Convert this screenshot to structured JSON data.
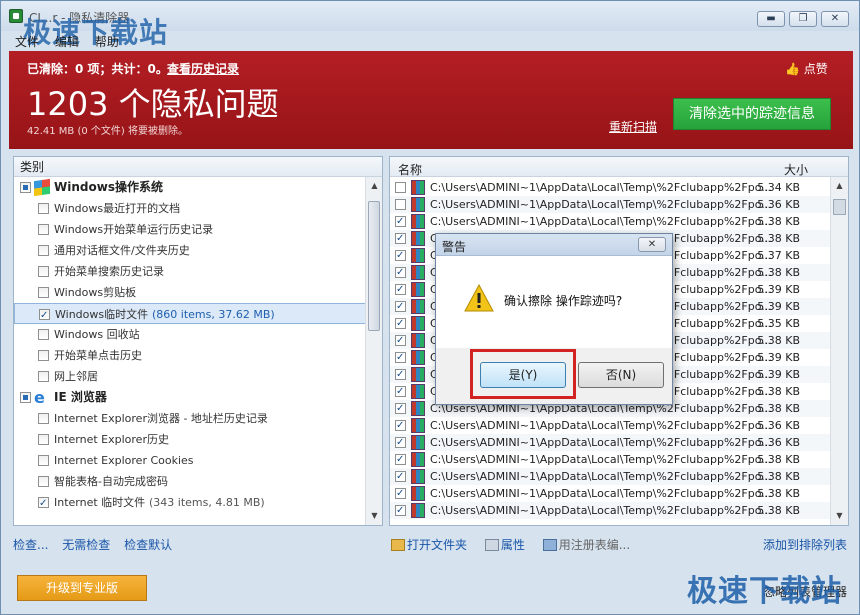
{
  "window": {
    "title": "CI...r - 隐私清除器",
    "minimize_icon": "minimize-icon",
    "restore_icon": "restore-icon",
    "close_icon": "close-icon"
  },
  "menu": [
    "文件",
    "编辑",
    "帮助"
  ],
  "watermark": "极速下载站",
  "banner": {
    "cleared_text": "已清除：0 项；共计：0。",
    "history_link": "查看历史记录",
    "issues_count": "1203 个隐私问题",
    "size_line": "42.41 MB (0 个文件) 将要被删除。",
    "like_label": "点赞",
    "rescan_link": "重新扫描",
    "clean_button": "清除选中的踪迹信息"
  },
  "left_panel": {
    "header": "类别",
    "rows": [
      {
        "type": "cat",
        "label": "Windows操作系统",
        "checkbox": "partial",
        "icon": "windows-logo-icon"
      },
      {
        "type": "item",
        "label": "Windows最近打开的文档",
        "checked": false
      },
      {
        "type": "item",
        "label": "Windows开始菜单运行历史记录",
        "checked": false
      },
      {
        "type": "item",
        "label": "通用对话框文件/文件夹历史",
        "checked": false
      },
      {
        "type": "item",
        "label": "开始菜单搜索历史记录",
        "checked": false
      },
      {
        "type": "item",
        "label": "Windows剪贴板",
        "checked": false
      },
      {
        "type": "item",
        "label": "Windows临时文件",
        "extra": "(860 items, 37.62 MB)",
        "checked": true,
        "selected": true
      },
      {
        "type": "item",
        "label": "Windows 回收站",
        "checked": false
      },
      {
        "type": "item",
        "label": "开始菜单点击历史",
        "checked": false
      },
      {
        "type": "item",
        "label": "网上邻居",
        "checked": false
      },
      {
        "type": "cat",
        "label": "IE 浏览器",
        "checkbox": "partial",
        "icon": "ie-logo-icon"
      },
      {
        "type": "item",
        "label": "Internet Explorer浏览器 - 地址栏历史记录",
        "checked": false
      },
      {
        "type": "item",
        "label": "Internet Explorer历史",
        "checked": false
      },
      {
        "type": "item",
        "label": "Internet Explorer Cookies",
        "checked": false
      },
      {
        "type": "item",
        "label": "智能表格-自动完成密码",
        "checked": false
      },
      {
        "type": "item",
        "label": "Internet 临时文件",
        "extra": "(343 items, 4.81 MB)",
        "checked": true
      }
    ]
  },
  "right_panel": {
    "col_name": "名称",
    "col_size": "大小",
    "files": [
      {
        "path": "C:\\Users\\ADMINI~1\\AppData\\Local\\Temp\\%2Fclubapp%2Fpo...",
        "size": "5.34 KB",
        "checked": false
      },
      {
        "path": "C:\\Users\\ADMINI~1\\AppData\\Local\\Temp\\%2Fclubapp%2Fpo...",
        "size": "5.36 KB",
        "checked": false
      },
      {
        "path": "C:\\Users\\ADMINI~1\\AppData\\Local\\Temp\\%2Fclubapp%2Fpo...",
        "size": "5.38 KB",
        "checked": true
      },
      {
        "path": "C:\\Users\\ADMINI~1\\AppData\\Local\\Temp\\%2Fclubapp%2Fpo...",
        "size": "5.38 KB",
        "checked": true
      },
      {
        "path": "C:\\Users\\ADMINI~1\\AppData\\Local\\Temp\\%2Fclubapp%2Fpo...",
        "size": "5.37 KB",
        "checked": true
      },
      {
        "path": "C:\\Users\\ADMINI~1\\AppData\\Local\\Temp\\%2Fclubapp%2Fpo...",
        "size": "5.38 KB",
        "checked": true
      },
      {
        "path": "C:\\Users\\ADMINI~1\\AppData\\Local\\Temp\\%2Fclubapp%2Fpo...",
        "size": "5.39 KB",
        "checked": true
      },
      {
        "path": "C:\\Users\\ADMINI~1\\AppData\\Local\\Temp\\%2Fclubapp%2Fpo...",
        "size": "5.39 KB",
        "checked": true
      },
      {
        "path": "C:\\Users\\ADMINI~1\\AppData\\Local\\Temp\\%2Fclubapp%2Fpo...",
        "size": "5.35 KB",
        "checked": true
      },
      {
        "path": "C:\\Users\\ADMINI~1\\AppData\\Local\\Temp\\%2Fclubapp%2Fpo...",
        "size": "5.38 KB",
        "checked": true
      },
      {
        "path": "C:\\Users\\ADMINI~1\\AppData\\Local\\Temp\\%2Fclubapp%2Fpo...",
        "size": "5.39 KB",
        "checked": true
      },
      {
        "path": "C:\\Users\\ADMINI~1\\AppData\\Local\\Temp\\%2Fclubapp%2Fpo...",
        "size": "5.39 KB",
        "checked": true
      },
      {
        "path": "C:\\Users\\ADMINI~1\\AppData\\Local\\Temp\\%2Fclubapp%2Fpo...",
        "size": "5.38 KB",
        "checked": true
      },
      {
        "path": "C:\\Users\\ADMINI~1\\AppData\\Local\\Temp\\%2Fclubapp%2Fpo...",
        "size": "5.38 KB",
        "checked": true
      },
      {
        "path": "C:\\Users\\ADMINI~1\\AppData\\Local\\Temp\\%2Fclubapp%2Fpo...",
        "size": "5.36 KB",
        "checked": true
      },
      {
        "path": "C:\\Users\\ADMINI~1\\AppData\\Local\\Temp\\%2Fclubapp%2Fpo...",
        "size": "5.36 KB",
        "checked": true
      },
      {
        "path": "C:\\Users\\ADMINI~1\\AppData\\Local\\Temp\\%2Fclubapp%2Fpo...",
        "size": "5.38 KB",
        "checked": true
      },
      {
        "path": "C:\\Users\\ADMINI~1\\AppData\\Local\\Temp\\%2Fclubapp%2Fpo...",
        "size": "5.38 KB",
        "checked": true
      },
      {
        "path": "C:\\Users\\ADMINI~1\\AppData\\Local\\Temp\\%2Fclubapp%2Fpo...",
        "size": "5.38 KB",
        "checked": true
      },
      {
        "path": "C:\\Users\\ADMINI~1\\AppData\\Local\\Temp\\%2Fclubapp%2Fpo...",
        "size": "5.38 KB",
        "checked": true
      }
    ]
  },
  "bottom": {
    "check_link": "检查...",
    "no_check_link": "无需检查",
    "check_default_link": "检查默认",
    "open_folder": "打开文件夹",
    "properties": "属性",
    "registry": "用注册表编...",
    "add_exclude": "添加到排除列表",
    "upgrade": "升级到专业版",
    "ignore_list": "忽略列表管理器"
  },
  "dialog": {
    "title": "警告",
    "message": "确认擦除  操作踪迹吗?",
    "yes": "是(Y)",
    "no": "否(N)"
  }
}
